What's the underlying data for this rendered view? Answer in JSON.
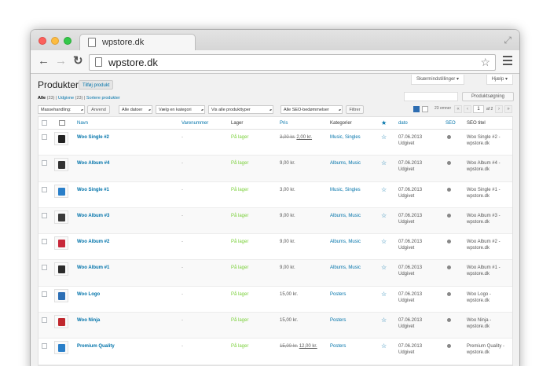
{
  "browser": {
    "tab_title": "wpstore.dk",
    "url": "wpstore.dk"
  },
  "header": {
    "screen_options": "Skærmindstillinger",
    "help": "Hjælp",
    "title": "Produkter",
    "add_new": "Tilføj produkt"
  },
  "views": {
    "all": "Alle",
    "all_count": "(23)",
    "published": "Udgivne",
    "published_count": "(23)",
    "sort": "Sortere produkter"
  },
  "search": {
    "button": "Produktsøgning"
  },
  "filters": {
    "bulk": "Massehandling:",
    "apply": "Anvend",
    "dates": "Alle datoer",
    "category": "Vælg en kategori",
    "product_type": "Vis alle produkttyper",
    "seo": "Alle SEO-bedømmelser",
    "filter": "Filtrer"
  },
  "pagination": {
    "count": "23 emner",
    "first": "«",
    "prev": "‹",
    "current": "1",
    "of": "af 2",
    "next": "›",
    "last": "»"
  },
  "columns": {
    "name": "Navn",
    "sku": "Varenummer",
    "stock": "Lager",
    "price": "Pris",
    "categories": "Kategorier",
    "featured": "★",
    "date": "dato",
    "seo": "SEO",
    "seo_title": "SEO titel"
  },
  "products": [
    {
      "name": "Woo Single #2",
      "sku": "-",
      "stock": "På lager",
      "price_old": "3,00 kr.",
      "price": "2,00 kr.",
      "categories": "Music, Singles",
      "featured": "☆",
      "date": "07.06.2013",
      "status": "Udgivet",
      "seo_title_1": "Woo Single #2 -",
      "seo_title_2": "wpstore.dk",
      "thumb_color": "#222222"
    },
    {
      "name": "Woo Album #4",
      "sku": "-",
      "stock": "På lager",
      "price_old": "",
      "price": "9,00 kr.",
      "categories": "Albums, Music",
      "featured": "☆",
      "date": "07.06.2013",
      "status": "Udgivet",
      "seo_title_1": "Woo Album #4 -",
      "seo_title_2": "wpstore.dk",
      "thumb_color": "#333333"
    },
    {
      "name": "Woo Single #1",
      "sku": "-",
      "stock": "På lager",
      "price_old": "",
      "price": "3,00 kr.",
      "categories": "Music, Singles",
      "featured": "☆",
      "date": "07.06.2013",
      "status": "Udgivet",
      "seo_title_1": "Woo Single #1 -",
      "seo_title_2": "wpstore.dk",
      "thumb_color": "#2a7fc9"
    },
    {
      "name": "Woo Album #3",
      "sku": "-",
      "stock": "På lager",
      "price_old": "",
      "price": "9,00 kr.",
      "categories": "Albums, Music",
      "featured": "☆",
      "date": "07.06.2013",
      "status": "Udgivet",
      "seo_title_1": "Woo Album #3 -",
      "seo_title_2": "wpstore.dk",
      "thumb_color": "#3a3a3a"
    },
    {
      "name": "Woo Album #2",
      "sku": "-",
      "stock": "På lager",
      "price_old": "",
      "price": "9,00 kr.",
      "categories": "Albums, Music",
      "featured": "☆",
      "date": "07.06.2013",
      "status": "Udgivet",
      "seo_title_1": "Woo Album #2 -",
      "seo_title_2": "wpstore.dk",
      "thumb_color": "#c8283a"
    },
    {
      "name": "Woo Album #1",
      "sku": "-",
      "stock": "På lager",
      "price_old": "",
      "price": "9,00 kr.",
      "categories": "Albums, Music",
      "featured": "☆",
      "date": "07.06.2013",
      "status": "Udgivet",
      "seo_title_1": "Woo Album #1 -",
      "seo_title_2": "wpstore.dk",
      "thumb_color": "#2b2b2b"
    },
    {
      "name": "Woo Logo",
      "sku": "-",
      "stock": "På lager",
      "price_old": "",
      "price": "15,00 kr.",
      "categories": "Posters",
      "featured": "☆",
      "date": "07.06.2013",
      "status": "Udgivet",
      "seo_title_1": "Woo Logo -",
      "seo_title_2": "wpstore.dk",
      "thumb_color": "#2d6fb5"
    },
    {
      "name": "Woo Ninja",
      "sku": "-",
      "stock": "På lager",
      "price_old": "",
      "price": "15,00 kr.",
      "categories": "Posters",
      "featured": "☆",
      "date": "07.06.2013",
      "status": "Udgivet",
      "seo_title_1": "Woo Ninja -",
      "seo_title_2": "wpstore.dk",
      "thumb_color": "#c0282e"
    },
    {
      "name": "Premium Quality",
      "sku": "-",
      "stock": "På lager",
      "price_old": "15,00 kr.",
      "price": "12,00 kr.",
      "categories": "Posters",
      "featured": "☆",
      "date": "07.06.2013",
      "status": "Udgivet",
      "seo_title_1": "Premium Quality -",
      "seo_title_2": "wpstore.dk",
      "thumb_color": "#2a7fc9"
    }
  ],
  "colors": {
    "link": "#0073aa",
    "in_stock": "#7ad03a",
    "seo_dot": "#888888"
  }
}
